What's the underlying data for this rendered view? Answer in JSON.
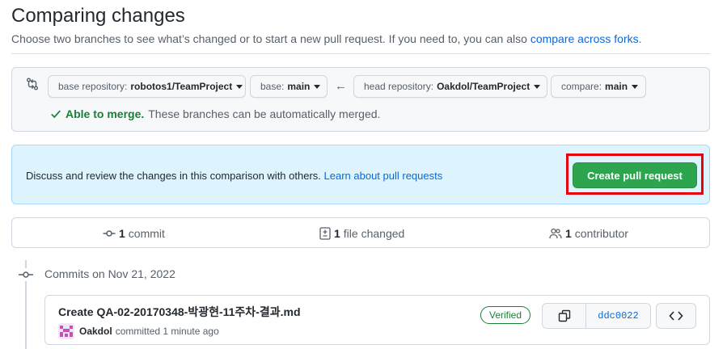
{
  "page": {
    "title": "Comparing changes",
    "subtitle": "Choose two branches to see what’s changed or to start a new pull request. If you need to, you can also ",
    "subtitle_link": "compare across forks",
    "subtitle_end": "."
  },
  "range": {
    "base_repo_label": "base repository:",
    "base_repo_value": "robotos1/TeamProject",
    "base_label": "base:",
    "base_value": "main",
    "head_repo_label": "head repository:",
    "head_repo_value": "Oakdol/TeamProject",
    "compare_label": "compare:",
    "compare_value": "main",
    "merge_ok": "Able to merge.",
    "merge_text": "These branches can be automatically merged."
  },
  "flash": {
    "text": "Discuss and review the changes in this comparison with others. ",
    "link": "Learn about pull requests",
    "button": "Create pull request"
  },
  "summary": {
    "commits_count": "1",
    "commits_label": "commit",
    "files_count": "1",
    "files_label": "file changed",
    "contributors_count": "1",
    "contributors_label": "contributor"
  },
  "commits": {
    "heading": "Commits on Nov 21, 2022",
    "items": [
      {
        "title": "Create QA-02-20170348-박광현-11주차-결과.md",
        "author": "Oakdol",
        "action": "committed 1 minute ago",
        "badge": "Verified",
        "sha": "ddc0022"
      }
    ]
  },
  "colors": {
    "accent_link": "#0969da",
    "success": "#1a7f37",
    "primary_button": "#2da44e",
    "highlight_outline": "#e8000b",
    "flash_bg": "#ddf4ff"
  }
}
